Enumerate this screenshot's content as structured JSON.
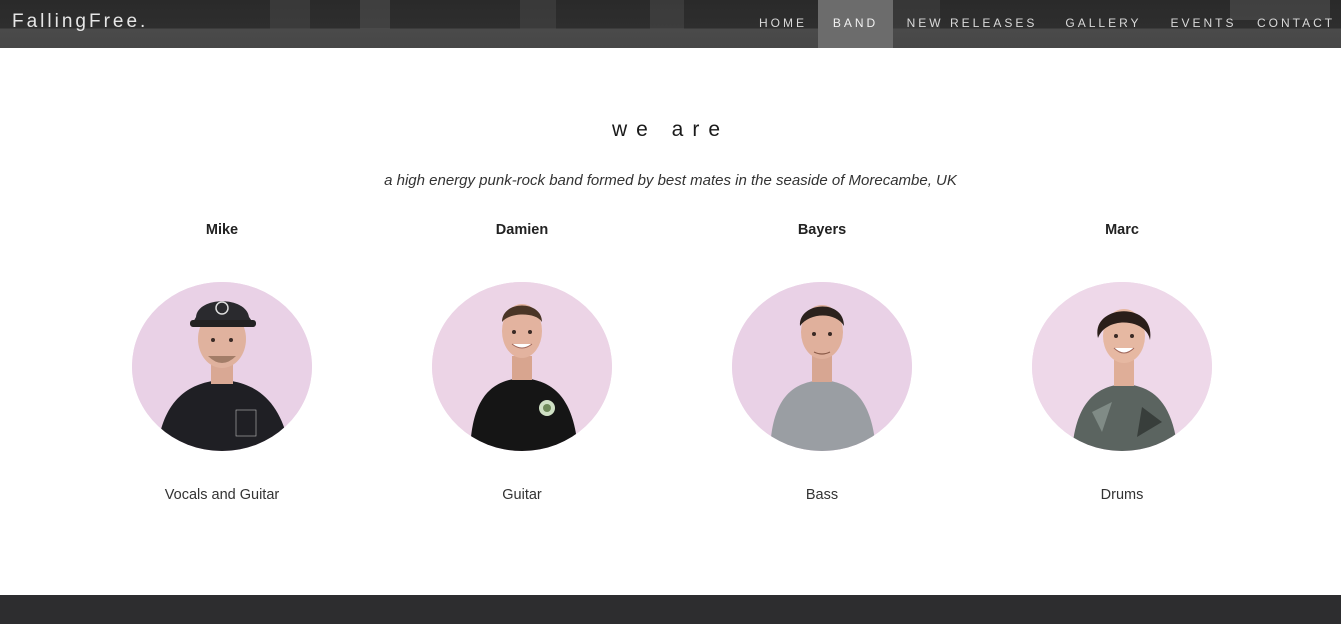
{
  "brand": "FallingFree.",
  "nav": {
    "home": "HOME",
    "band": "BAND",
    "releases": "NEW RELEASES",
    "gallery": "GALLERY",
    "events": "EVENTS",
    "contact": "CONTACT",
    "active": "BAND"
  },
  "section": {
    "heading": "we are",
    "tagline": "a high energy punk-rock band formed by best mates in the seaside of Morecambe, UK"
  },
  "members": [
    {
      "name": "Mike",
      "role": "Vocals and Guitar"
    },
    {
      "name": "Damien",
      "role": "Guitar"
    },
    {
      "name": "Bayers",
      "role": "Bass"
    },
    {
      "name": "Marc",
      "role": "Drums"
    }
  ],
  "colors": {
    "navbar": "#2e2e2e",
    "active_nav": "#6c6c6c",
    "portrait_background": "#e9d1e6",
    "footer": "#2d2d2f"
  }
}
